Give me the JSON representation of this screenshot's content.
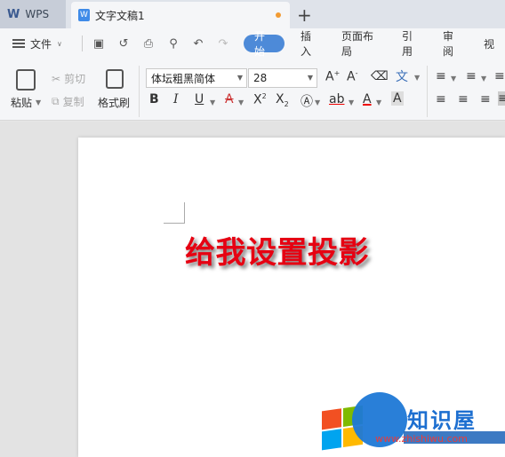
{
  "titlebar": {
    "app_tab": "WPS",
    "doc_tab": "文字文稿1",
    "new_tab": "+"
  },
  "menubar": {
    "file": "文件",
    "tabs": [
      "开始",
      "插入",
      "页面布局",
      "引用",
      "审阅",
      "视"
    ]
  },
  "ribbon": {
    "paste": "粘贴",
    "cut": "剪切",
    "copy": "复制",
    "format_painter": "格式刷",
    "font_name": "体坛粗黑简体",
    "font_size": "28"
  },
  "document": {
    "text": "给我设置投影"
  },
  "watermark": {
    "brand": "知识屋",
    "url": "www.zhishiwu.com"
  },
  "colors": {
    "accent": "#4d8ad8",
    "doc_text": "#e60012"
  }
}
